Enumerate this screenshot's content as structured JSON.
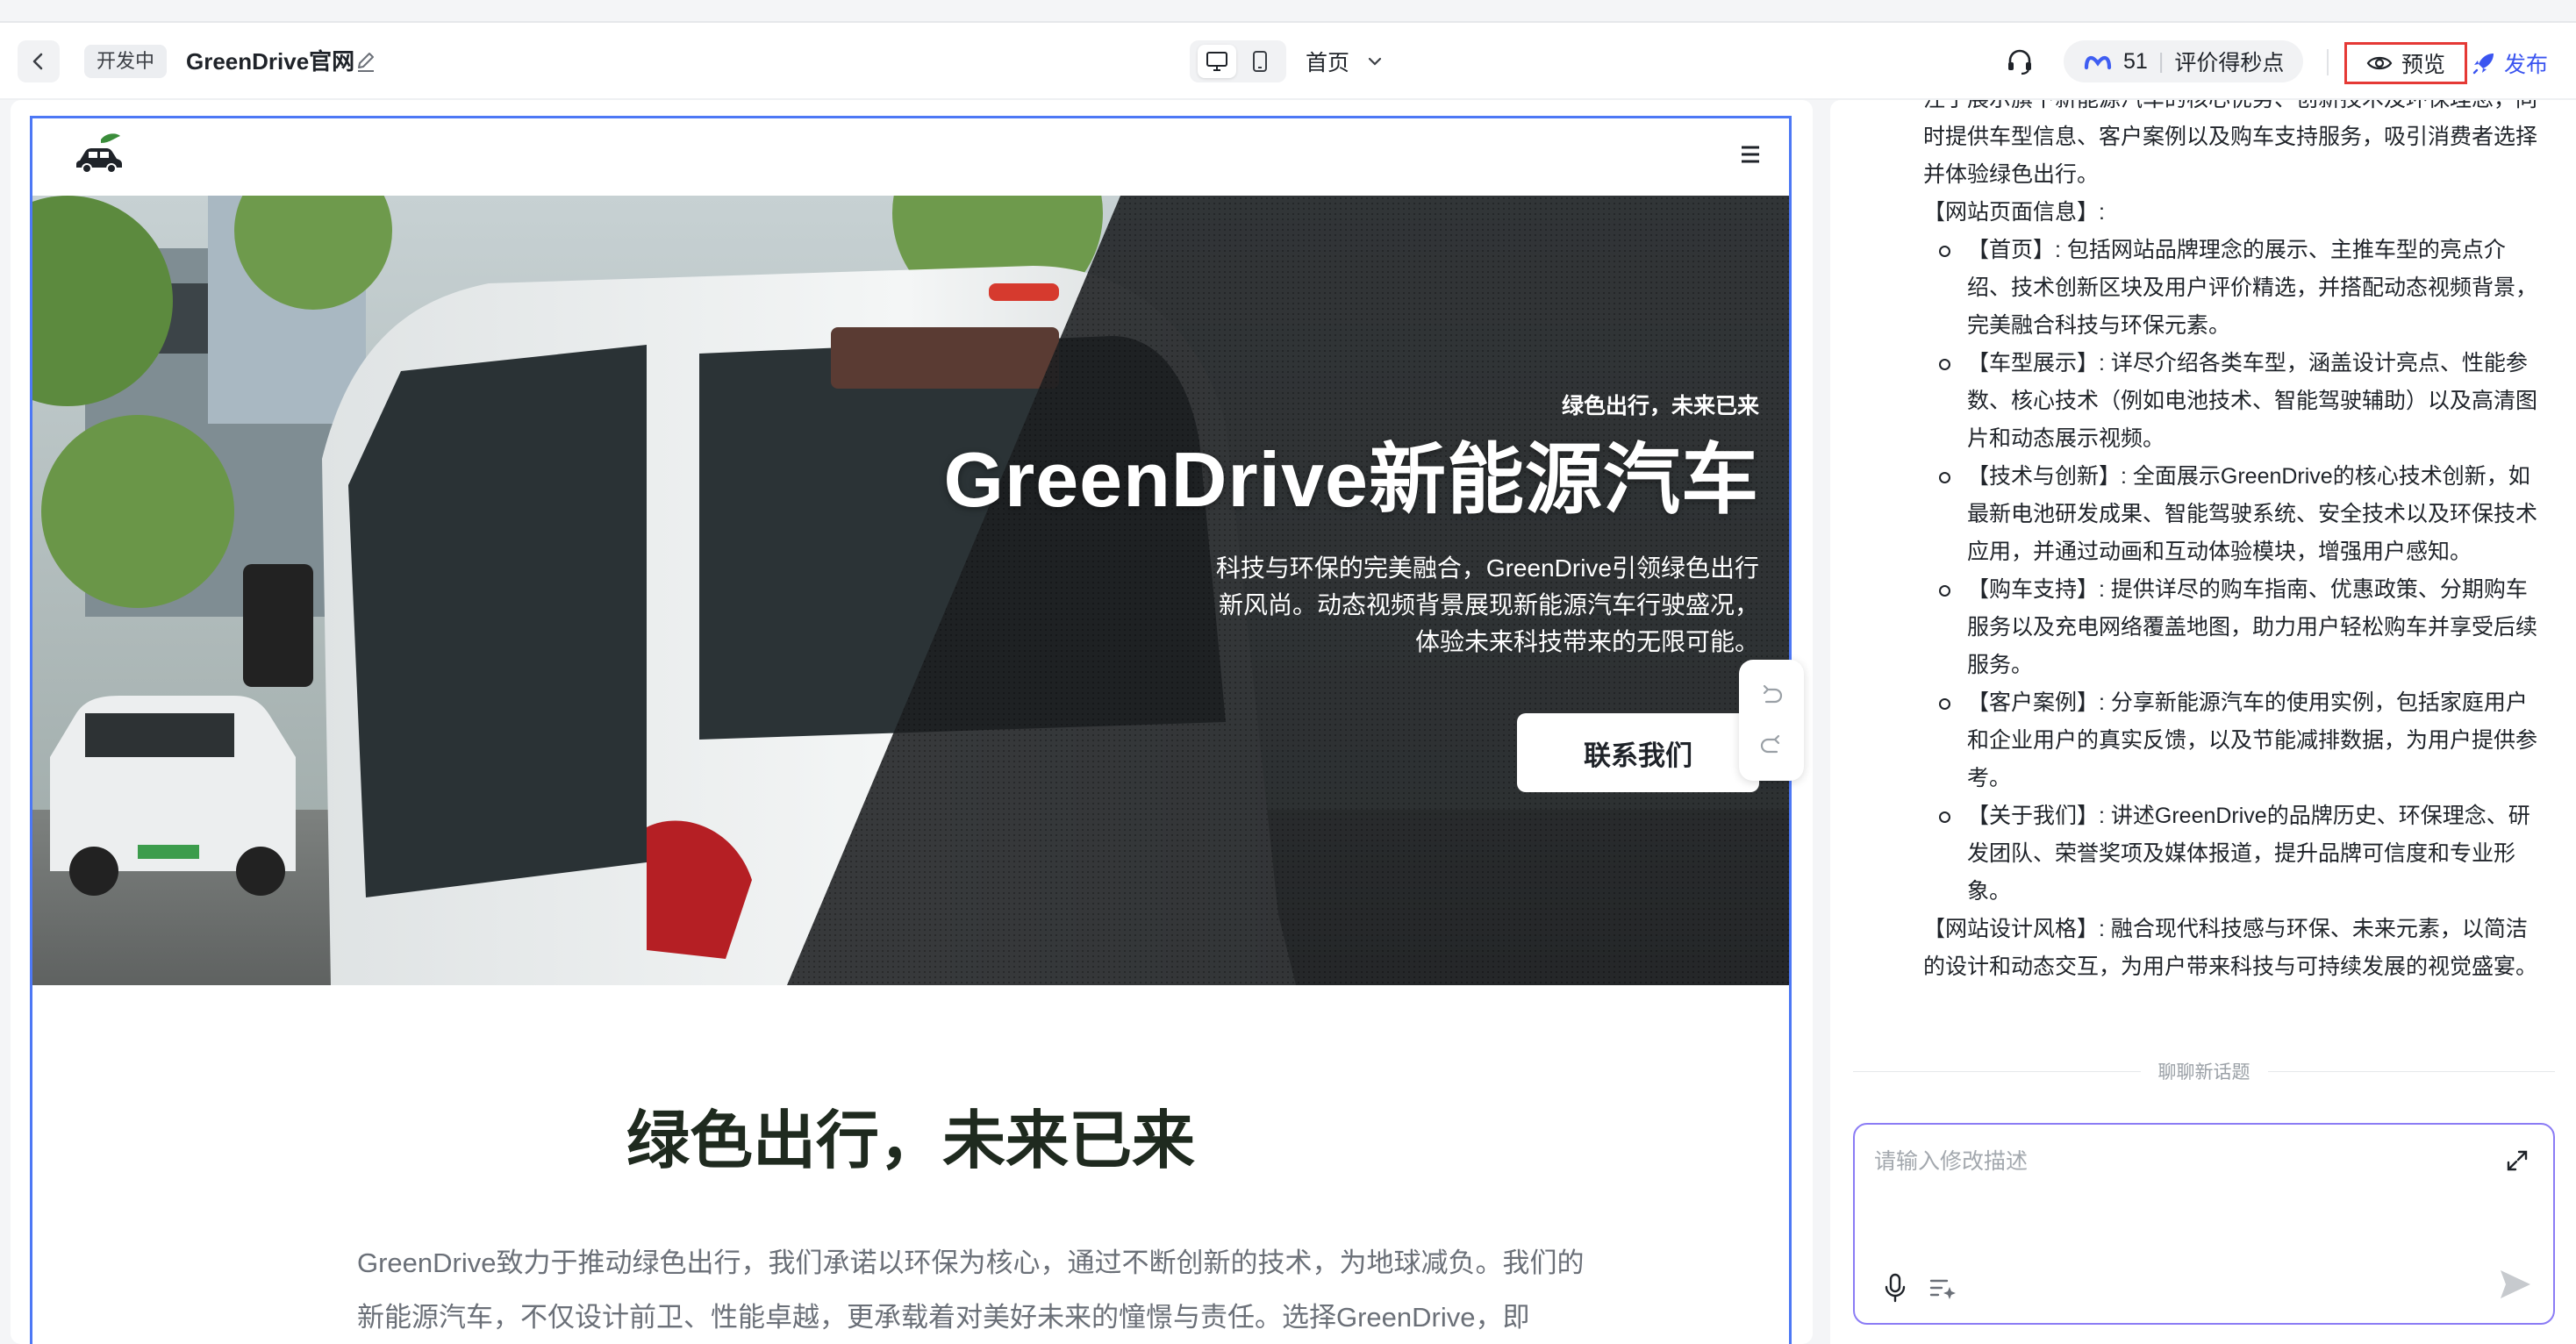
{
  "topbar": {
    "status_tag": "开发中",
    "site_name": "GreenDrive官网",
    "page_selector": "首页",
    "score_count": "51",
    "score_label": "评价得秒点",
    "preview_label": "预览",
    "publish_label": "发布"
  },
  "site": {
    "hero": {
      "kicker": "绿色出行，未来已来",
      "title": "GreenDrive新能源汽车",
      "description": "科技与环保的完美融合，GreenDrive引领绿色出行新风尚。动态视频背景展现新能源汽车行驶盛况，体验未来科技带来的无限可能。",
      "cta": "联系我们"
    },
    "section": {
      "title": "绿色出行，未来已来",
      "body": "GreenDrive致力于推动绿色出行，我们承诺以环保为核心，通过不断创新的技术，为地球减负。我们的新能源汽车，不仅设计前卫、性能卓越，更承载着对美好未来的憧憬与责任。选择GreenDrive，即"
    }
  },
  "chat": {
    "intro_partial": "注于展示旗下新能源汽车的核心优势、创新技术及环保理念，同时提供车型信息、客户案例以及购车支持服务，吸引消费者选择并体验绿色出行。",
    "pages_heading": "【网站页面信息】:",
    "pages": [
      "【首页】: 包括网站品牌理念的展示、主推车型的亮点介绍、技术创新区块及用户评价精选，并搭配动态视频背景，完美融合科技与环保元素。",
      "【车型展示】: 详尽介绍各类车型，涵盖设计亮点、性能参数、核心技术（例如电池技术、智能驾驶辅助）以及高清图片和动态展示视频。",
      "【技术与创新】: 全面展示GreenDrive的核心技术创新，如最新电池研发成果、智能驾驶系统、安全技术以及环保技术应用，并通过动画和互动体验模块，增强用户感知。",
      "【购车支持】: 提供详尽的购车指南、优惠政策、分期购车服务以及充电网络覆盖地图，助力用户轻松购车并享受后续服务。",
      "【客户案例】: 分享新能源汽车的使用实例，包括家庭用户和企业用户的真实反馈，以及节能减排数据，为用户提供参考。",
      "【关于我们】: 讲述GreenDrive的品牌历史、环保理念、研发团队、荣誉奖项及媒体报道，提升品牌可信度和专业形象。"
    ],
    "style_text": "【网站设计风格】: 融合现代科技感与环保、未来元素，以简洁的设计和动态交互，为用户带来科技与可持续发展的视觉盛宴。",
    "new_topic": "聊聊新话题",
    "input_placeholder": "请输入修改描述"
  },
  "colors": {
    "accent_blue": "#4d78f5",
    "publish_blue": "#3a54f0",
    "preview_highlight": "#e53935",
    "input_border": "#8b7cf5"
  },
  "icons": [
    "back-icon",
    "edit-icon",
    "desktop-icon",
    "mobile-icon",
    "chevron-down-icon",
    "headset-icon",
    "meta-icon",
    "eye-icon",
    "rocket-icon",
    "car-logo-icon",
    "hamburger-icon",
    "undo-icon",
    "redo-icon",
    "expand-icon",
    "mic-icon",
    "prompt-icon",
    "send-icon"
  ]
}
